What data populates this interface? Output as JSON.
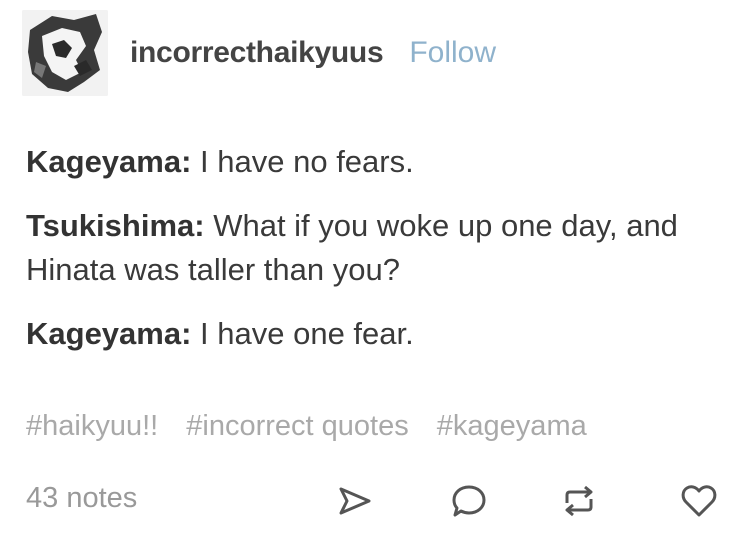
{
  "post": {
    "username": "incorrecthaikyuus",
    "follow_label": "Follow",
    "lines": [
      {
        "speaker": "Kageyama:",
        "text": " I have no fears."
      },
      {
        "speaker": "Tsukishima:",
        "text": " What if you woke up one day, and Hinata was taller than you?"
      },
      {
        "speaker": "Kageyama:",
        "text": " I have one fear."
      }
    ],
    "tags": [
      "#haikyuu!!",
      "#incorrect quotes",
      "#kageyama"
    ],
    "notes": "43 notes",
    "actions": {
      "share_icon": "send-icon",
      "reply_icon": "reply-bubble-icon",
      "reblog_icon": "reblog-icon",
      "like_icon": "heart-icon"
    },
    "colors": {
      "follow": "#8fb2cc",
      "tags": "#a9a9a9",
      "icons": "#555555"
    }
  }
}
